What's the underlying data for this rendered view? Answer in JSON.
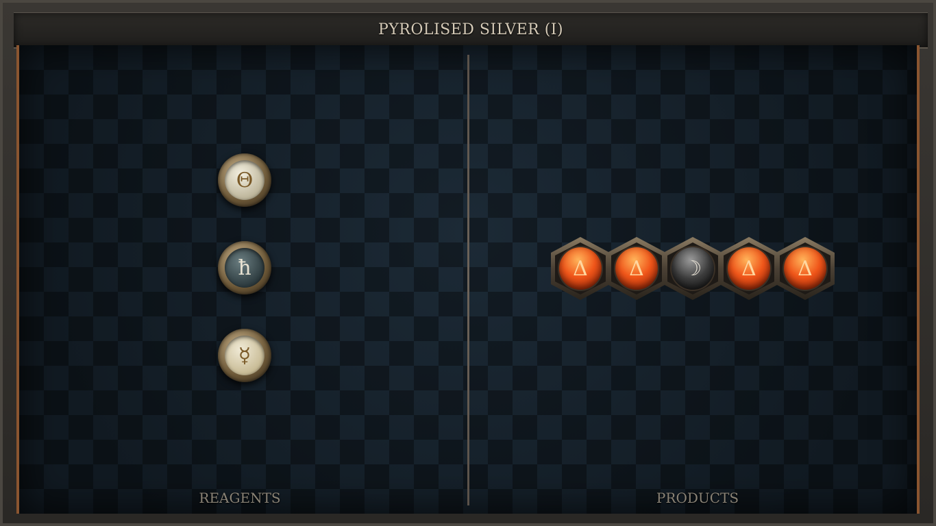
{
  "window": {
    "title": "PYROLISED SILVER (I)"
  },
  "reagents": {
    "label": "REAGENTS",
    "items": [
      {
        "element": "salt",
        "glyph": "Θ",
        "icon": "salt-symbol-icon"
      },
      {
        "element": "lead",
        "glyph": "ħ",
        "icon": "lead-symbol-icon"
      },
      {
        "element": "quicksilver",
        "glyph": "☿",
        "icon": "quicksilver-symbol-icon"
      }
    ]
  },
  "products": {
    "label": "PRODUCTS",
    "atoms": [
      {
        "element": "fire",
        "glyph": "Δ"
      },
      {
        "element": "fire",
        "glyph": "Δ"
      },
      {
        "element": "silver",
        "glyph": "☽"
      },
      {
        "element": "fire",
        "glyph": "Δ"
      },
      {
        "element": "fire",
        "glyph": "Δ"
      }
    ]
  },
  "colors": {
    "accent": "#8a5530",
    "fire": "#f0561a",
    "text": "#d6cbb8"
  }
}
